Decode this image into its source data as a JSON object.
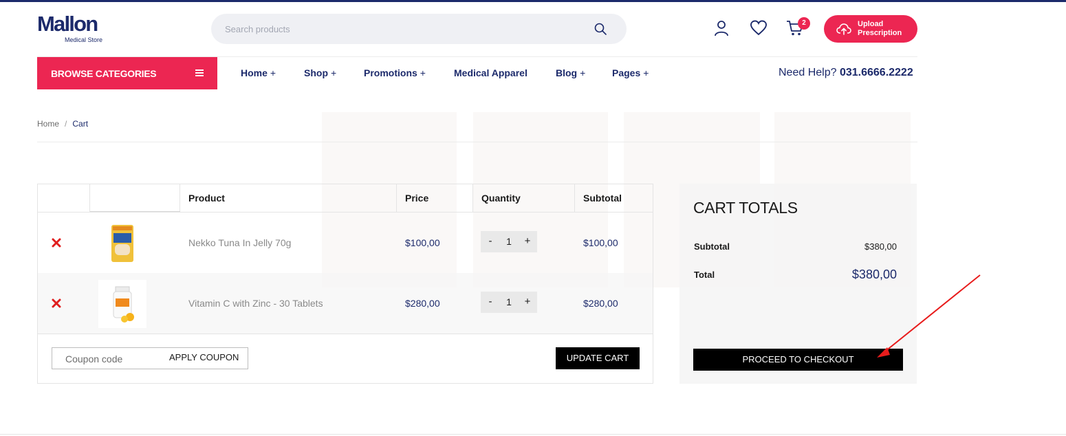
{
  "brand": {
    "name": "Mallon",
    "tagline": "Medical Store"
  },
  "search": {
    "placeholder": "Search products"
  },
  "header": {
    "cart_count": "2",
    "upload_label": "Upload Prescription"
  },
  "nav": {
    "browse_label": "BROWSE CATEGORIES",
    "items": [
      {
        "label": "Home",
        "has_children": true
      },
      {
        "label": "Shop",
        "has_children": true
      },
      {
        "label": "Promotions",
        "has_children": true
      },
      {
        "label": "Medical Apparel",
        "has_children": false
      },
      {
        "label": "Blog",
        "has_children": true
      },
      {
        "label": "Pages",
        "has_children": true
      }
    ],
    "help_text": "Need Help?",
    "help_phone": "031.6666.2222"
  },
  "breadcrumb": {
    "home": "Home",
    "separator": "/",
    "current": "Cart"
  },
  "cart": {
    "columns": {
      "product": "Product",
      "price": "Price",
      "quantity": "Quantity",
      "subtotal": "Subtotal"
    },
    "items": [
      {
        "name": "Nekko Tuna In Jelly 70g",
        "price": "$100,00",
        "quantity": "1",
        "subtotal": "$100,00"
      },
      {
        "name": "Vitamin C with Zinc - 30 Tablets",
        "price": "$280,00",
        "quantity": "1",
        "subtotal": "$280,00"
      }
    ],
    "coupon_placeholder": "Coupon code",
    "apply_coupon_label": "APPLY COUPON",
    "update_cart_label": "UPDATE CART"
  },
  "totals": {
    "title": "CART TOTALS",
    "subtotal_label": "Subtotal",
    "subtotal_value": "$380,00",
    "total_label": "Total",
    "total_value": "$380,00",
    "checkout_label": "PROCEED TO CHECKOUT"
  },
  "colors": {
    "accent": "#ec2652",
    "navy": "#1c2a6b",
    "remove": "#e01e1e",
    "annotation_arrow": "#e81c1c"
  }
}
